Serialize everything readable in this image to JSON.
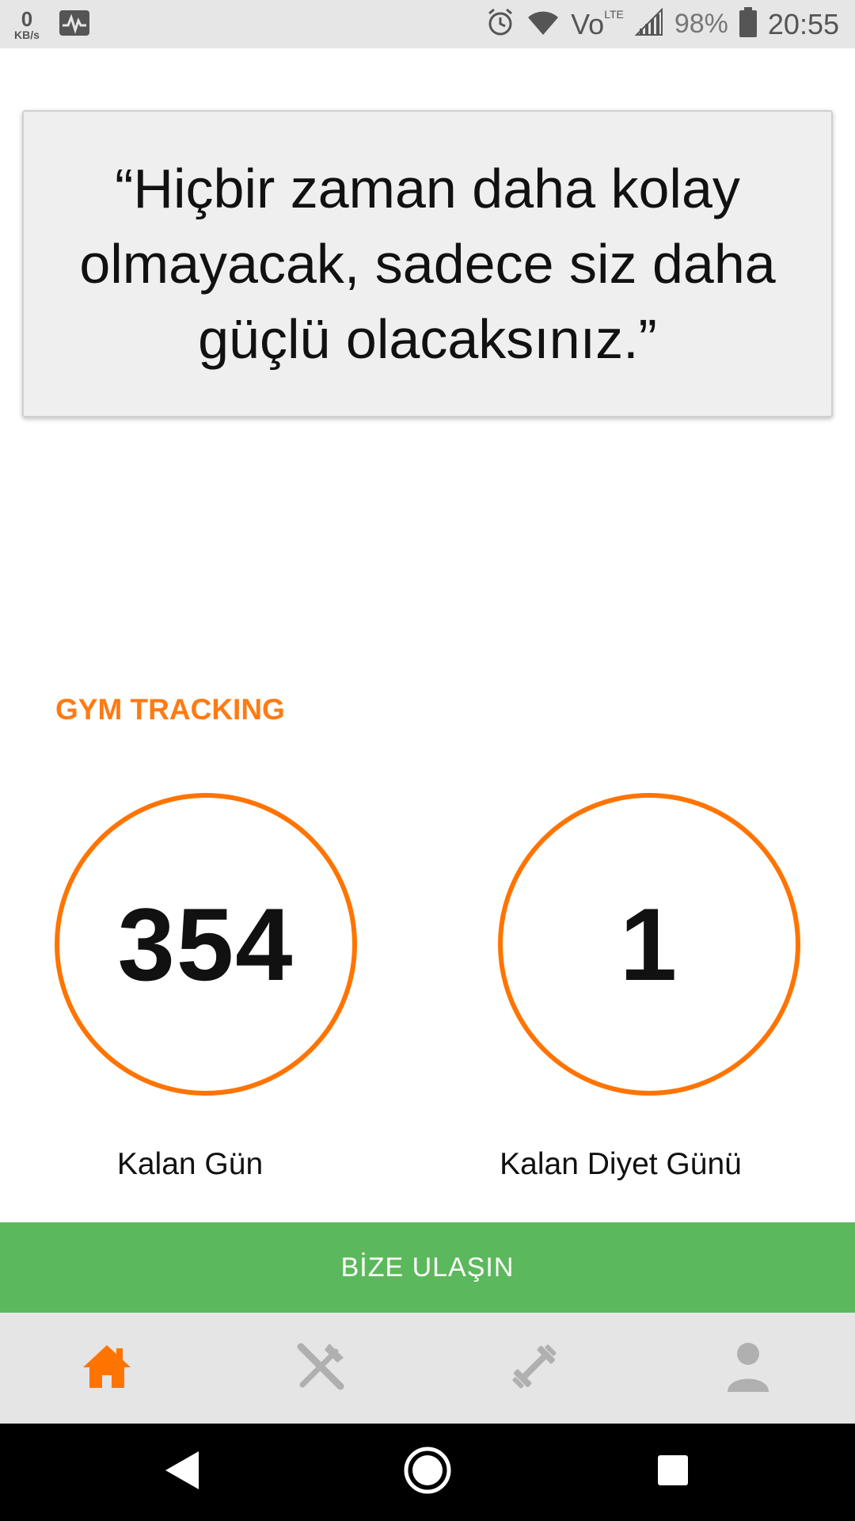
{
  "status_bar": {
    "speed_value": "0",
    "speed_unit": "KB/s",
    "network": "Vo",
    "network_sub": "LTE",
    "battery": "98%",
    "time": "20:55"
  },
  "quote": {
    "text": "“Hiçbir zaman daha kolay olmayacak, sadece siz daha güçlü olacaksınız.”"
  },
  "section": {
    "title": "GYM TRACKING"
  },
  "counters": [
    {
      "value": "354",
      "label": "Kalan Gün"
    },
    {
      "value": "1",
      "label": "Kalan Diyet Günü"
    }
  ],
  "contact_button": {
    "label": "BİZE ULAŞIN",
    "color": "#5cb85c"
  },
  "bottom_nav": {
    "items": [
      {
        "icon": "home-icon",
        "active": true
      },
      {
        "icon": "diet-icon",
        "active": false
      },
      {
        "icon": "workout-icon",
        "active": false
      },
      {
        "icon": "profile-icon",
        "active": false
      }
    ],
    "active_color": "#ff7400",
    "inactive_color": "#b0b0b0"
  },
  "colors": {
    "accent": "#ff7400",
    "title": "#ff7a13"
  }
}
